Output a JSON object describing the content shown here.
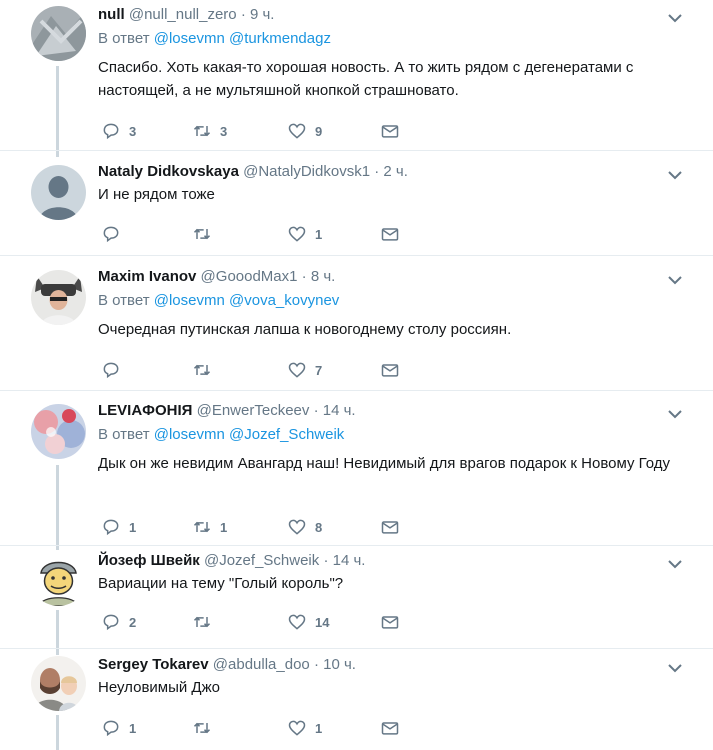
{
  "tweets": [
    {
      "name": "null",
      "handle": "@null_null_zero",
      "dot": "·",
      "time": "9 ч.",
      "reply_prefix": "В ответ",
      "mentions": [
        "@losevmn",
        "@turkmendagz"
      ],
      "text": "Спасибо. Хоть какая-то хорошая новость. А то жить рядом с дегенератами с настоящей, а не мультяшной кнопкой страшновато.",
      "replies": "3",
      "retweets": "3",
      "likes": "9"
    },
    {
      "name": "Nataly Didkovskaya",
      "handle": "@NatalyDidkovsk1",
      "dot": "·",
      "time": "2 ч.",
      "text": "И не рядом тоже",
      "replies": "",
      "retweets": "",
      "likes": "1"
    },
    {
      "name": "Maxim Ivanov",
      "handle": "@GooodMax1",
      "dot": "·",
      "time": "8 ч.",
      "reply_prefix": "В ответ",
      "mentions": [
        "@losevmn",
        "@vova_kovynev"
      ],
      "text": "Очередная путинская лапша к новогоднему столу россиян.",
      "replies": "",
      "retweets": "",
      "likes": "7"
    },
    {
      "name": "LEVIAФОНІЯ",
      "handle": "@EnwerTeckeev",
      "dot": "·",
      "time": "14 ч.",
      "reply_prefix": "В ответ",
      "mentions": [
        "@losevmn",
        "@Jozef_Schweik"
      ],
      "text": "Дык он же невидим Авангард наш! Невидимый для врагов подарок к Новому Году",
      "replies": "1",
      "retweets": "1",
      "likes": "8"
    },
    {
      "name": "Йозеф Швейк",
      "handle": "@Jozef_Schweik",
      "dot": "·",
      "time": "14 ч.",
      "text": "Вариации на тему \"Голый король\"?",
      "replies": "2",
      "retweets": "",
      "likes": "14"
    },
    {
      "name": "Sergey Tokarev",
      "handle": "@abdulla_doo",
      "dot": "·",
      "time": "10 ч.",
      "text": "Неуловимый Джо",
      "replies": "1",
      "retweets": "",
      "likes": "1"
    }
  ],
  "icons": {
    "reply": "reply-icon",
    "retweet": "retweet-icon",
    "like": "heart-icon",
    "dm": "envelope-icon",
    "more": "chevron-down-icon"
  },
  "colors": {
    "link": "#1b95e0",
    "muted": "#657786",
    "thread_line": "#ccd6dd"
  }
}
